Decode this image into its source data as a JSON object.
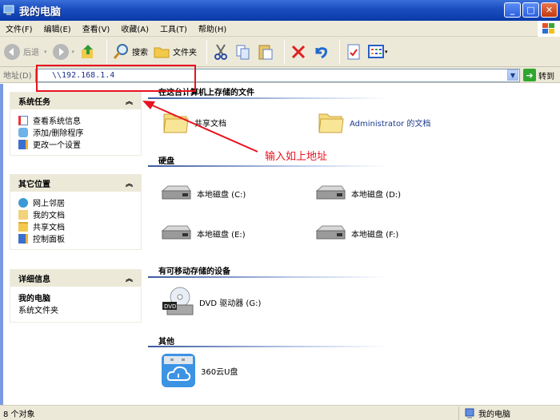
{
  "window": {
    "title": "我的电脑",
    "controls": {
      "minimize": "_",
      "maximize": "□",
      "close": "✕"
    }
  },
  "menubar": {
    "items": [
      "文件(F)",
      "编辑(E)",
      "查看(V)",
      "收藏(A)",
      "工具(T)",
      "帮助(H)"
    ]
  },
  "toolbar": {
    "back_label": "后退",
    "forward_label": "",
    "search_label": "搜索",
    "folders_label": "文件夹"
  },
  "addressbar": {
    "label": "地址(D)",
    "value": "\\\\192.168.1.4",
    "go_label": "转到"
  },
  "sidebar": {
    "system_tasks": {
      "title": "系统任务",
      "items": [
        "查看系统信息",
        "添加/删除程序",
        "更改一个设置"
      ]
    },
    "other_places": {
      "title": "其它位置",
      "items": [
        "网上邻居",
        "我的文档",
        "共享文档",
        "控制面板"
      ]
    },
    "details": {
      "title": "详细信息",
      "name": "我的电脑",
      "type": "系统文件夹"
    },
    "collapse_glyph": "︽"
  },
  "content": {
    "sections": [
      {
        "title": "在这台计算机上存储的文件",
        "items": [
          "共享文档",
          "Administrator 的文档"
        ]
      },
      {
        "title": "硬盘",
        "items": [
          "本地磁盘 (C:)",
          "本地磁盘 (D:)",
          "本地磁盘 (E:)",
          "本地磁盘 (F:)"
        ]
      },
      {
        "title": "有可移动存储的设备",
        "items": [
          "DVD 驱动器 (G:)"
        ]
      },
      {
        "title": "其他",
        "items": [
          "360云U盘"
        ]
      }
    ]
  },
  "statusbar": {
    "left": "8 个对象",
    "right": "我的电脑"
  },
  "annotation": {
    "text": "输入如上地址",
    "color": "#e8121f"
  }
}
